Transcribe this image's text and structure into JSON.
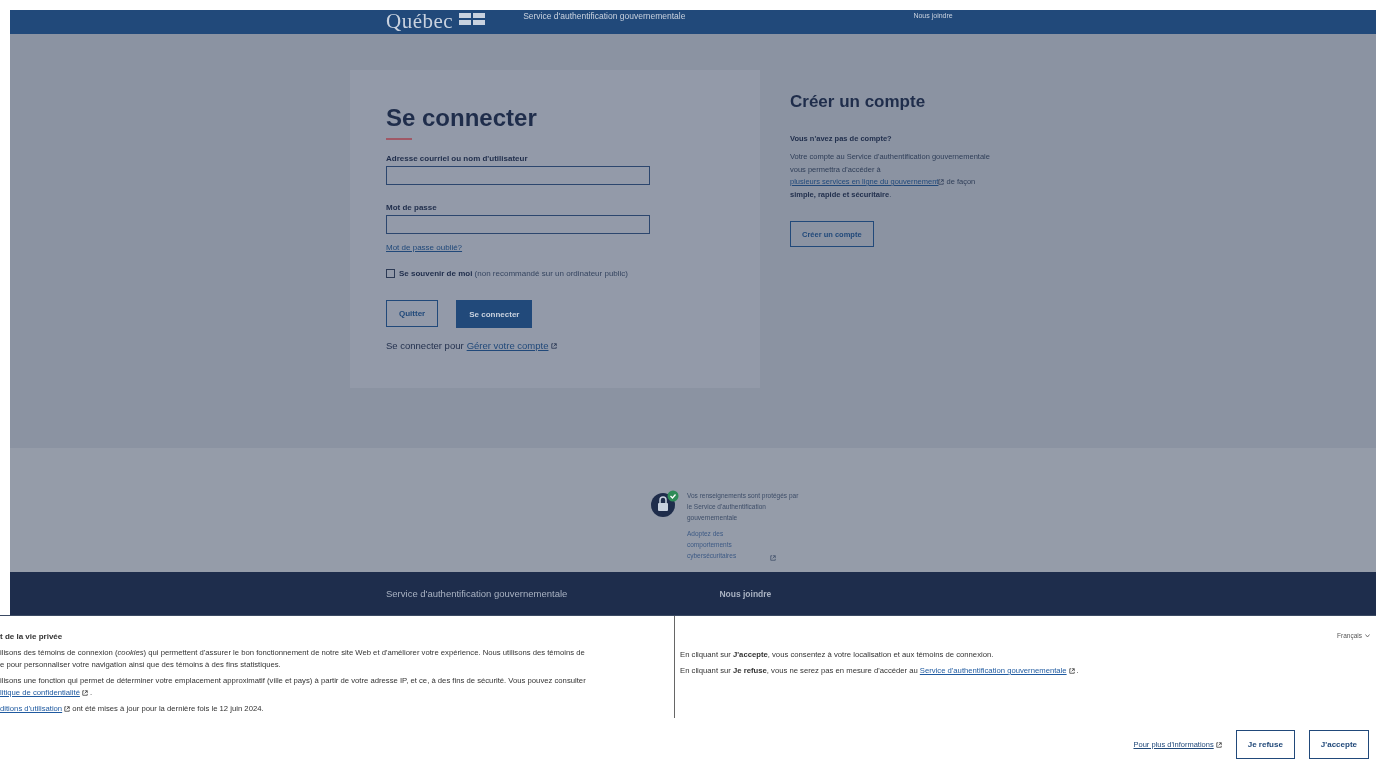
{
  "header": {
    "logo": "Québec",
    "service": "Service d'authentification gouvernementale",
    "contact": "Nous joindre"
  },
  "login": {
    "title": "Se connecter",
    "fields": [
      {
        "label": "Adresse courriel ou nom d'utilisateur",
        "kind": "text"
      },
      {
        "label": "Mot de passe",
        "kind": "password"
      }
    ],
    "forgot": "Mot de passe oublié?",
    "remember": {
      "label": "Se souvenir de moi",
      "note": "(non recommandé sur un ordinateur public)",
      "checked": false
    },
    "buttons": [
      {
        "label": "Quitter",
        "kind": "secondary"
      },
      {
        "label": "Se connecter",
        "kind": "primary"
      }
    ],
    "manage": {
      "prefix": "Se connecter pour",
      "link": "Gérer votre compte"
    }
  },
  "create": {
    "title": "Créer un compte",
    "question": "Vous n'avez pas de compte?",
    "text": "Votre compte au Service d'authentification gouvernementale vous permettra d'accéder à",
    "link": "plusieurs services en ligne du gouvernement",
    "rest": "de façon **simple, rapide et sécuritaire**.",
    "button": "Créer un compte"
  },
  "security": {
    "text": "Vos renseignements sont protégés par le Service d'authentification gouvernementale",
    "link": "Adoptez des comportements cybersécuritaires"
  },
  "footer": {
    "title": "Service d'authentification gouvernementale",
    "contact": "Nous joindre"
  },
  "banner": {
    "title": "t de la vie privée",
    "left_lines": [
      {
        "kind": "text",
        "text": "ilisons des témoins de connexion (*cookies*) qui permettent d'assurer le bon fonctionnement de notre site Web et d'améliorer votre expérience. Nous utilisons des témoins de"
      },
      {
        "kind": "text",
        "text": "e pour personnaliser votre navigation ainsi que des témoins à des fins statistiques."
      },
      {
        "kind": "text",
        "text": "ilisons une fonction qui permet de déterminer votre emplacement approximatif (ville et pays) à partir de votre adresse IP, et ce, à des fins de sécurité. Vous pouvez consulter"
      },
      {
        "kind": "link",
        "link": "litique de confidentialité",
        "after": "."
      },
      {
        "kind": "link",
        "link": "ditions d'utilisation",
        "after": "ont été mises à jour pour la dernière fois le 12 juin 2024."
      }
    ],
    "right_lines": [
      {
        "text": "En cliquant sur **J'accepte**, vous consentez à votre localisation et aux témoins de connexion."
      },
      {
        "text": "En cliquant sur **Je refuse**, vous ne serez pas en mesure d'accéder au",
        "link": "Service d'authentification gouvernementale",
        "after": "."
      }
    ],
    "language": "Français",
    "more": "Pour plus d'informations",
    "buttons": [
      "Je refuse",
      "J'accepte"
    ]
  }
}
